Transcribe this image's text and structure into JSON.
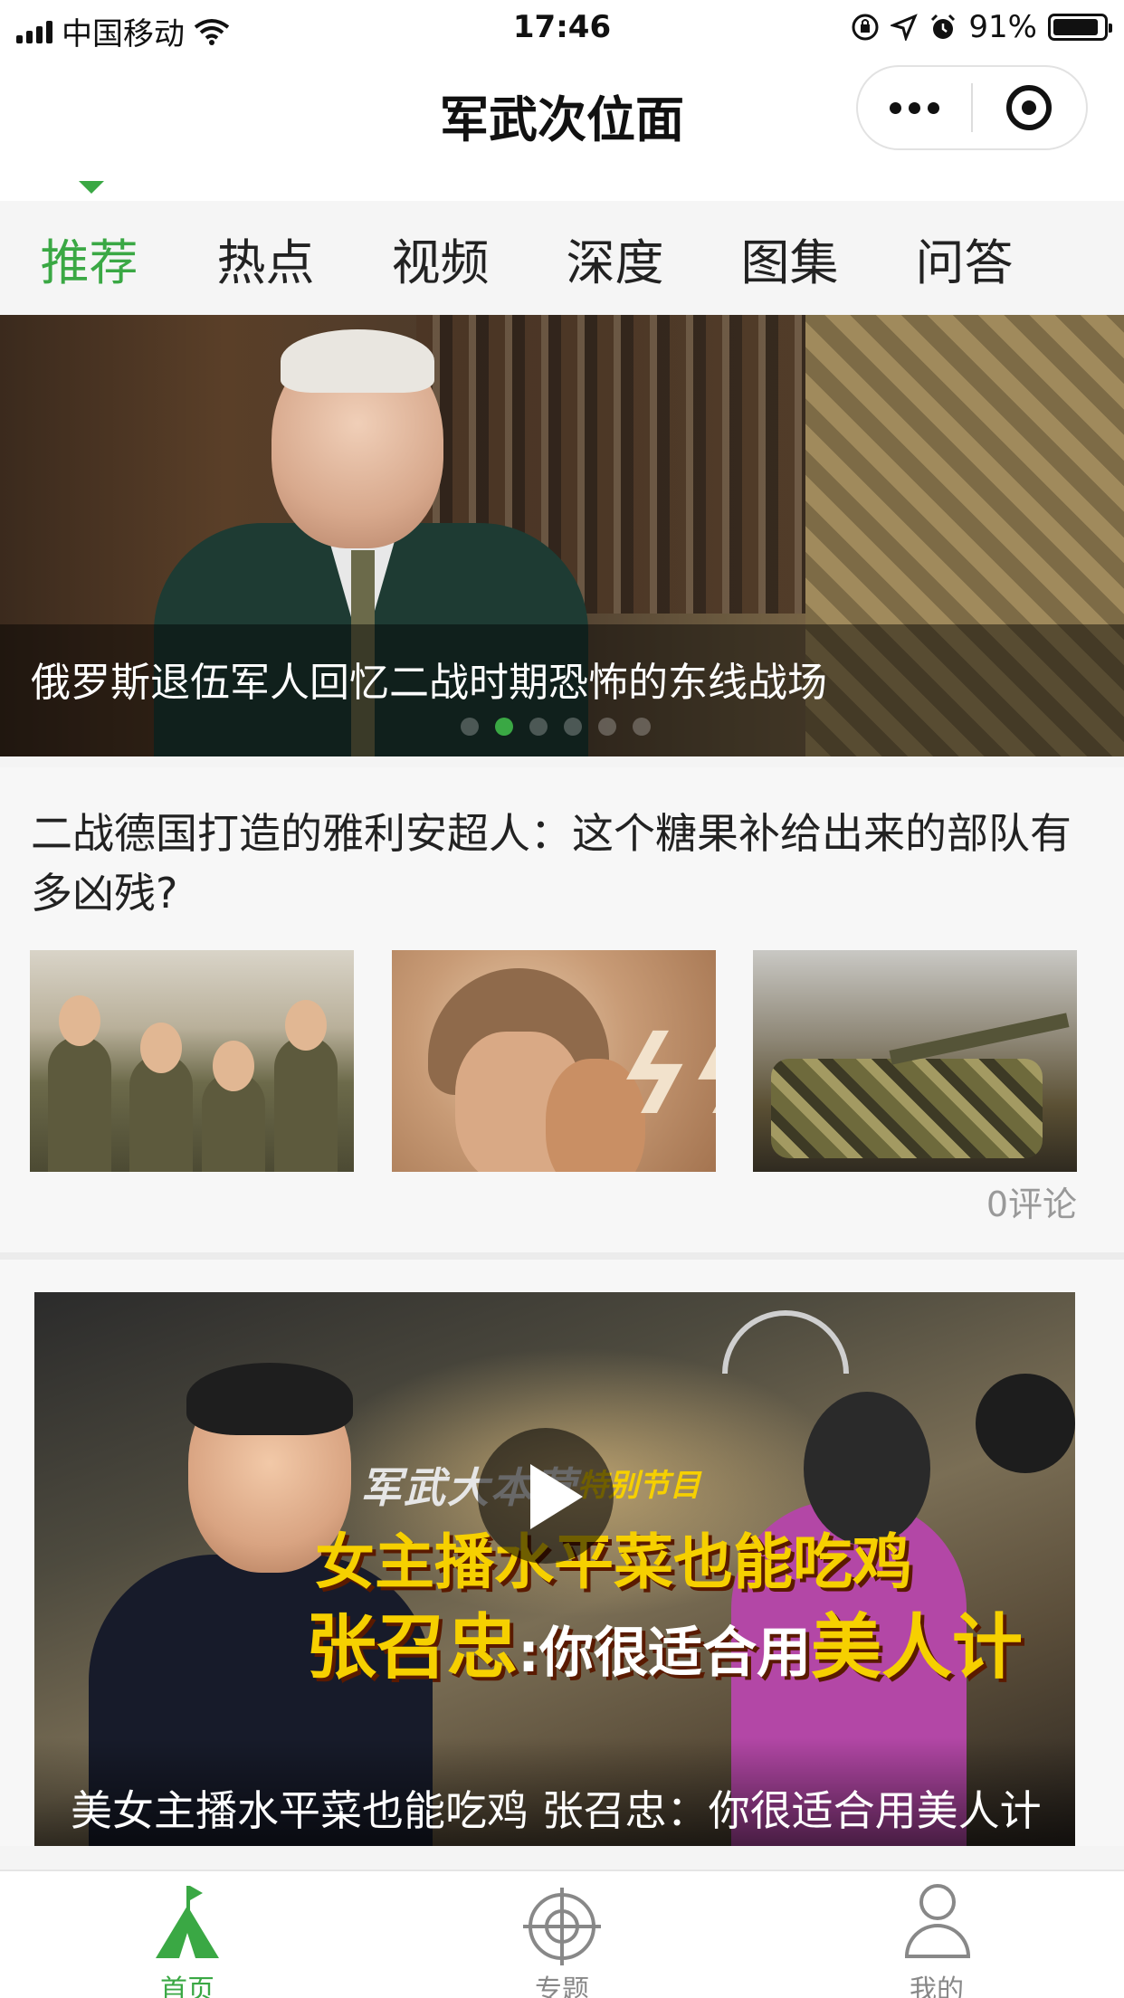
{
  "status_bar": {
    "carrier": "中国移动",
    "time": "17:46",
    "battery_percent": "91%",
    "battery_level": 0.91,
    "icons": [
      "signal-icon",
      "wifi-icon",
      "rotation-lock-icon",
      "location-icon",
      "alarm-icon",
      "battery-icon"
    ]
  },
  "nav": {
    "title": "军武次位面",
    "more_icon": "more-dots-icon",
    "close_icon": "target-close-icon"
  },
  "tabs": [
    {
      "label": "推荐",
      "active": true
    },
    {
      "label": "热点"
    },
    {
      "label": "视频"
    },
    {
      "label": "深度"
    },
    {
      "label": "图集"
    },
    {
      "label": "问答"
    }
  ],
  "banner": {
    "caption": "俄罗斯退伍军人回忆二战时期恐怖的东线战场",
    "slide_count": 6,
    "active_slide": 2
  },
  "articles": [
    {
      "title": "二战德国打造的雅利安超人：这个糖果补给出来的部队有多凶残?",
      "comments": "0评论",
      "thumbnails": [
        "soldiers-photo",
        "propaganda-poster",
        "tank-crew-photo"
      ]
    }
  ],
  "video": {
    "overlay_logo": "军武大本营",
    "overlay_badge": "特别节目",
    "overlay_line1": "女主播水平菜也能吃鸡",
    "overlay_line2_a": "张召忠",
    "overlay_line2_b": ":你很适合用",
    "overlay_line2_c": "美人计",
    "caption": "美女主播水平菜也能吃鸡 张召忠：你很适合用美人计"
  },
  "tabbar": [
    {
      "label": "首页",
      "icon": "tent-home-icon",
      "active": true
    },
    {
      "label": "专题",
      "icon": "crosshair-icon"
    },
    {
      "label": "我的",
      "icon": "user-icon"
    }
  ],
  "colors": {
    "accent": "#3aa844",
    "inactive": "#888888",
    "caption_text": "#ffffff"
  }
}
